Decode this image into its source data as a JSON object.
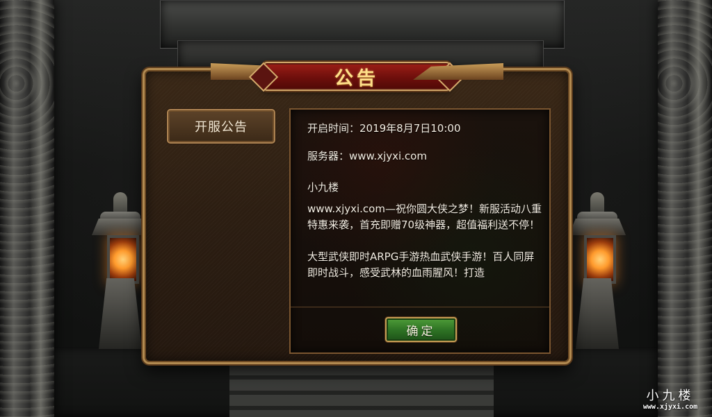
{
  "dialog": {
    "title": "公告",
    "tab_label": "开服公告",
    "lines": {
      "open_time": "开启时间：2019年8月7日10:00",
      "server": "服务器：www.xjyxi.com",
      "brand": "小九楼"
    },
    "paragraphs": [
      "www.xjyxi.com—祝你圆大侠之梦！新服活动八重特惠来袭，首充即赠70级神器，超值福利送不停！",
      "大型武侠即时ARPG手游热血武侠手游！百人同屏即时战斗，感受武林的血雨腥风！打造"
    ],
    "confirm_label": "确定"
  },
  "watermark": {
    "title": "小九楼",
    "domain": "www.xjyxi.com"
  },
  "colors": {
    "dialog_border": "#b28a50",
    "title_plate": "#6e0f0c",
    "title_text": "#ffe08a",
    "confirm_button": "#2f7425",
    "lantern_glow": "#ff9b2d"
  },
  "icons": [
    "dragon-pillar-left",
    "dragon-pillar-right",
    "stone-lantern-left",
    "stone-lantern-right"
  ]
}
